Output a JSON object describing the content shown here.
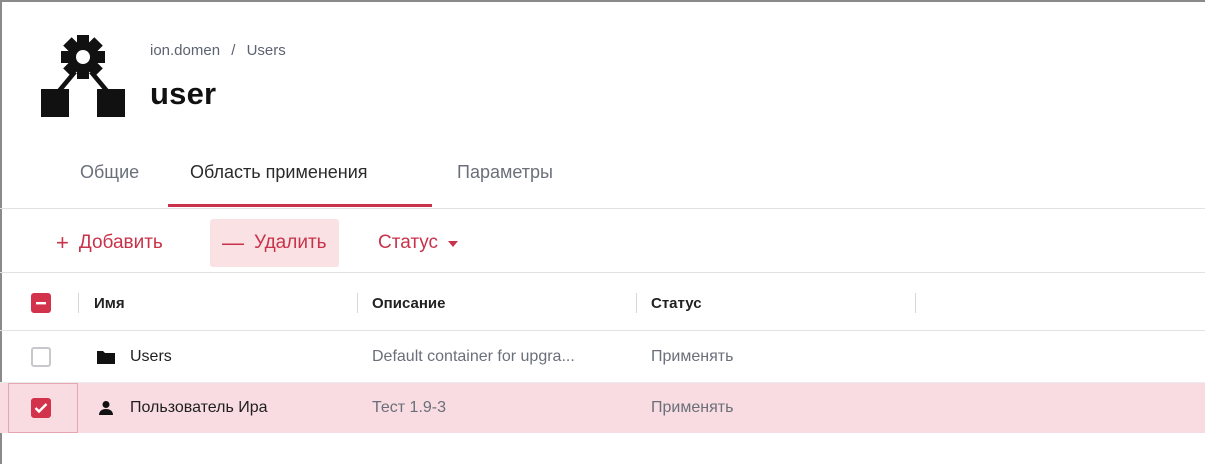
{
  "breadcrumb": {
    "parent": "ion.domen",
    "separator": "/",
    "current": "Users"
  },
  "title": "user",
  "header_icon": "gpo-settings-icon",
  "tabs": [
    {
      "label": "Общие",
      "active": false
    },
    {
      "label": "Область применения",
      "active": true
    },
    {
      "label": "Параметры",
      "active": false
    }
  ],
  "toolbar": {
    "add_symbol": "+",
    "add_label": "Добавить",
    "delete_symbol": "—",
    "delete_label": "Удалить",
    "status_label": "Статус"
  },
  "table": {
    "select_all_state": "indeterminate",
    "columns": [
      "Имя",
      "Описание",
      "Статус"
    ],
    "rows": [
      {
        "icon": "folder-icon",
        "name": "Users",
        "description": "Default container for upgra...",
        "status": "Применять",
        "checked": false
      },
      {
        "icon": "user-icon",
        "name": "Пользователь Ира",
        "description": "Тест 1.9-3",
        "status": "Применять",
        "checked": true
      }
    ]
  },
  "colors": {
    "accent": "#c8324a",
    "selected_row": "#f8dce1",
    "pressed_button": "#f9e1e4"
  }
}
